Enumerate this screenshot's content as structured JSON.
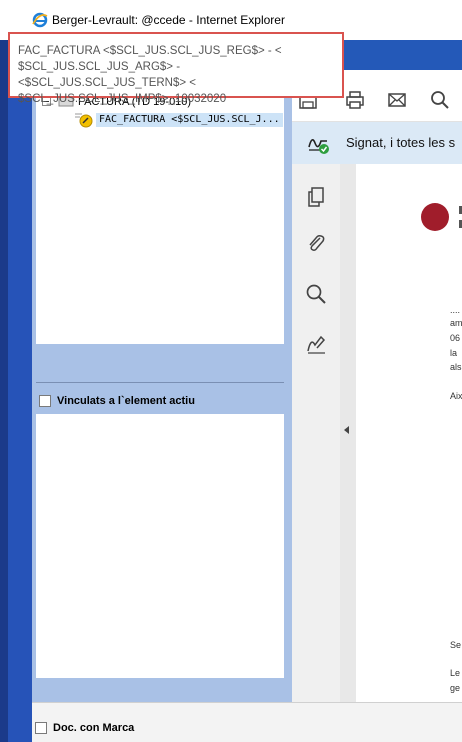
{
  "window": {
    "title": "Berger-Levrault: @ccede - Internet Explorer",
    "browser_icon": "internet-explorer-icon"
  },
  "tooltip": {
    "lines": [
      "FAC_FACTURA <$SCL_JUS.SCL_JUS_REG$> - <",
      "$SCL_JUS.SCL_JUS_ARG$> - <$SCL_JUS.SCL_JUS_TERN$> <",
      "$SCL_JUS.SCL_JUS_IMP$>_10032020"
    ]
  },
  "tree": {
    "root_label": "FACTURA (TD 19-010)",
    "child_label": "FAC_FACTURA <$SCL_JUS.SCL_J..."
  },
  "linked": {
    "label": "Vinculats a l`element actiu",
    "checked": false
  },
  "bottom": {
    "marca_label": "Doc. con Marca",
    "checked": false
  },
  "viewer": {
    "toolbar_icons": [
      "save-icon",
      "print-icon",
      "email-icon",
      "search-icon"
    ],
    "signed_text": "Signat, i totes les s",
    "side_icons": [
      "pages-icon",
      "attachment-icon",
      "search-icon",
      "signature-icon"
    ],
    "doc_fragments": [
      "....",
      "am",
      "06",
      "la",
      "als",
      "Aix",
      "Se",
      "Le",
      "ge"
    ]
  },
  "colors": {
    "frame_blue": "#2653b8",
    "panel_blue": "#a9c1e6",
    "tooltip_border": "#d9534f",
    "signed_bar": "#dbe9f6",
    "seal_red": "#a01d2b"
  }
}
